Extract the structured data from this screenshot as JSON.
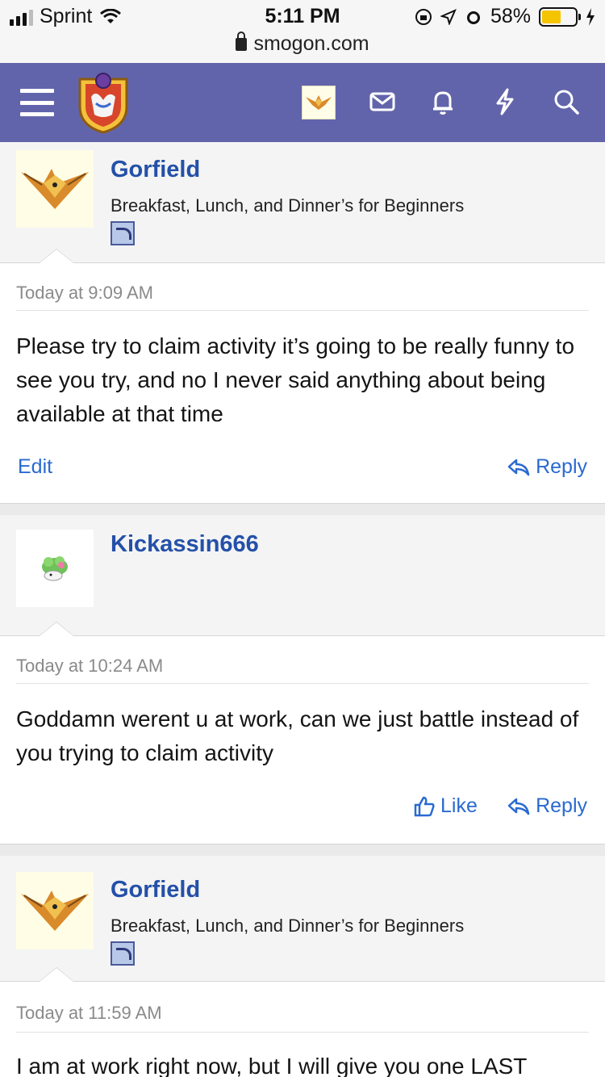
{
  "status_bar": {
    "carrier": "Sprint",
    "time": "5:11 PM",
    "url": "smogon.com",
    "battery": "58%",
    "battery_level": 0.58
  },
  "nav": {
    "icons": [
      "menu-icon",
      "site-logo",
      "user-avatar",
      "mail-icon",
      "bell-icon",
      "bolt-icon",
      "search-icon"
    ]
  },
  "posts": [
    {
      "username": "Gorfield",
      "user_title": "Breakfast, Lunch, and Dinner’s for Beginners",
      "timestamp": "Today at 9:09 AM",
      "text": "Please try to claim activity it’s going to be really funny to see you try, and no I never said anything about being available at that time",
      "actions": {
        "edit": "Edit",
        "reply": "Reply"
      }
    },
    {
      "username": "Kickassin666",
      "timestamp": "Today at 10:24 AM",
      "text": "Goddamn werent u at work, can we just battle instead of you trying to claim activity",
      "actions": {
        "like": "Like",
        "reply": "Reply"
      }
    },
    {
      "username": "Gorfield",
      "user_title": "Breakfast, Lunch, and Dinner’s for Beginners",
      "timestamp": "Today at 11:59 AM",
      "text": "I am at work right now, but I will give you one LAST"
    }
  ],
  "colors": {
    "nav_bg": "#6264ab",
    "link": "#2a6ad0",
    "username": "#2450a8"
  }
}
